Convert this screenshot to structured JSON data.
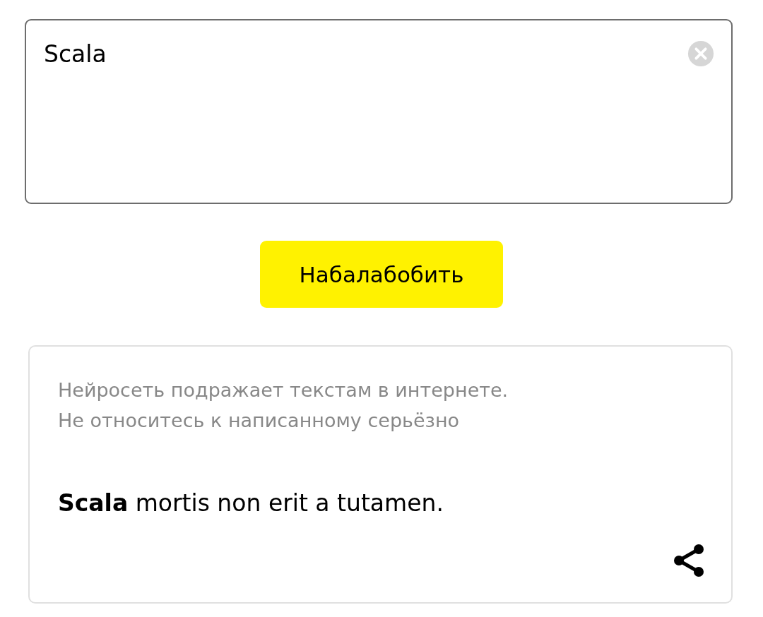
{
  "input": {
    "value": "Scala"
  },
  "button": {
    "label": "Набалабобить"
  },
  "result": {
    "disclaimer": [
      "Нейросеть подражает текстам в интернете.",
      "Не относитесь к написанному серьёзно"
    ],
    "text": "**Scala** mortis non erit a tutamen."
  }
}
